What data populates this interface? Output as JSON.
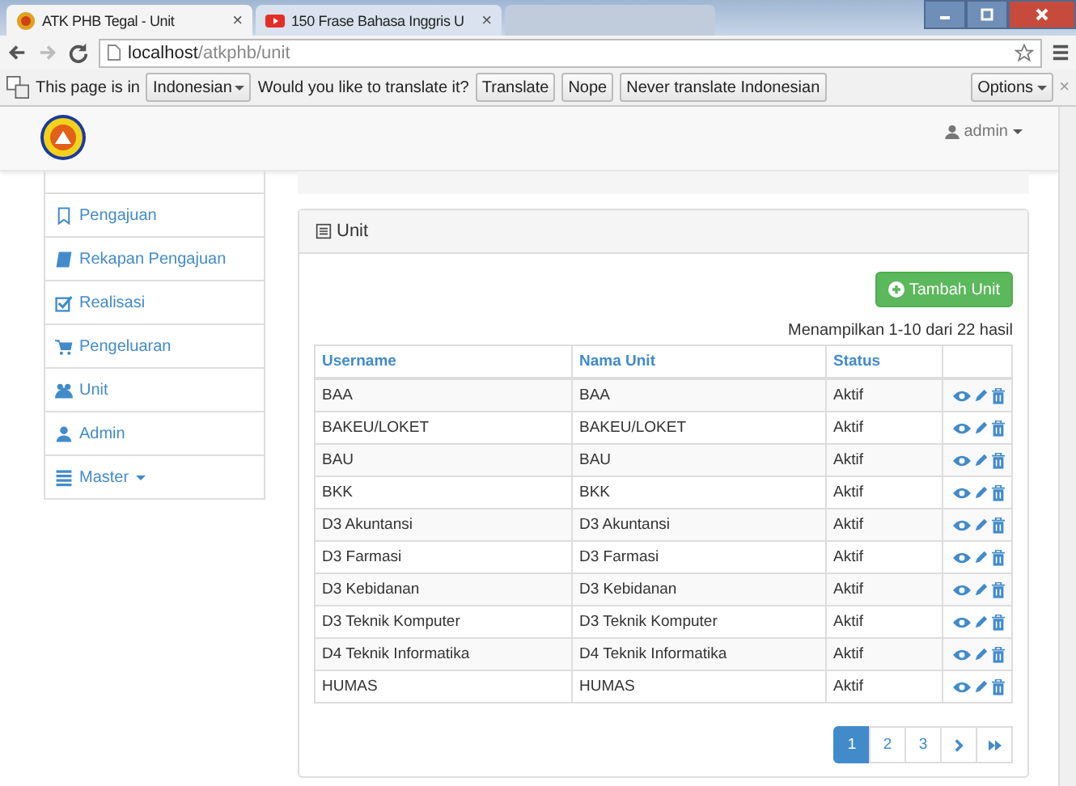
{
  "browser": {
    "tabs": [
      {
        "title": "ATK PHB Tegal - Unit",
        "selected": true,
        "close": "×"
      },
      {
        "title": "150 Frase Bahasa Inggris U",
        "selected": false,
        "close": "×"
      }
    ],
    "url_host": "localhost",
    "url_path": "/atkphb/unit"
  },
  "translate_bar": {
    "prefix": "This page is in",
    "language": "Indonesian",
    "question": "Would you like to translate it?",
    "buttons": [
      "Translate",
      "Nope",
      "Never translate Indonesian"
    ],
    "options": "Options",
    "close": "×"
  },
  "navbar": {
    "user": "admin"
  },
  "sidebar": {
    "items": [
      {
        "label": "Pengajuan"
      },
      {
        "label": "Rekapan Pengajuan"
      },
      {
        "label": "Realisasi"
      },
      {
        "label": "Pengeluaran"
      },
      {
        "label": "Unit"
      },
      {
        "label": "Admin"
      },
      {
        "label": "Master",
        "dropdown": true
      }
    ]
  },
  "panel": {
    "title": "Unit",
    "add_button": "Tambah Unit",
    "summary": "Menampilkan 1-10 dari 22 hasil"
  },
  "table": {
    "columns": [
      "Username",
      "Nama Unit",
      "Status"
    ],
    "rows": [
      [
        "BAA",
        "BAA",
        "Aktif"
      ],
      [
        "BAKEU/LOKET",
        "BAKEU/LOKET",
        "Aktif"
      ],
      [
        "BAU",
        "BAU",
        "Aktif"
      ],
      [
        "BKK",
        "BKK",
        "Aktif"
      ],
      [
        "D3 Akuntansi",
        "D3 Akuntansi",
        "Aktif"
      ],
      [
        "D3 Farmasi",
        "D3 Farmasi",
        "Aktif"
      ],
      [
        "D3 Kebidanan",
        "D3 Kebidanan",
        "Aktif"
      ],
      [
        "D3 Teknik Komputer",
        "D3 Teknik Komputer",
        "Aktif"
      ],
      [
        "D4 Teknik Informatika",
        "D4 Teknik Informatika",
        "Aktif"
      ],
      [
        "HUMAS",
        "HUMAS",
        "Aktif"
      ]
    ]
  },
  "pagination": [
    {
      "kind": "page",
      "label": "1",
      "selected": true
    },
    {
      "kind": "page",
      "label": "2",
      "selected": false
    },
    {
      "kind": "page",
      "label": "3",
      "selected": false
    },
    {
      "kind": "next",
      "selected": false
    },
    {
      "kind": "last",
      "selected": false
    }
  ]
}
